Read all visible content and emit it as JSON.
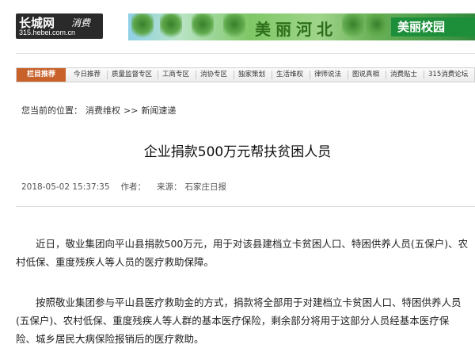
{
  "header": {
    "logo_main": "长城网",
    "logo_sub": "消费",
    "logo_url": "315.hebei.com.cn",
    "banner_title": "美丽河北",
    "banner_tag": "美丽校园"
  },
  "nav": {
    "label": "栏目推荐",
    "items": [
      "今日推荐",
      "质量监督专区",
      "工商专区",
      "消协专区",
      "独家策划",
      "生活维权",
      "律师说法",
      "图说真相",
      "消费贴士",
      "315消费论坛"
    ]
  },
  "breadcrumb": {
    "prefix": "您当前的位置：",
    "level1": "消费维权",
    "sep": ">>",
    "level2": "新闻速递"
  },
  "article": {
    "title": "企业捐款500万元帮扶贫困人员",
    "date": "2018-05-02 15:37:35",
    "author_label": "作者：",
    "source_label": "来源：",
    "source": "石家庄日报",
    "paragraphs": [
      "近日，敬业集团向平山县捐款500万元，用于对该县建档立卡贫困人口、特困供养人员(五保户)、农村低保、重度残疾人等人员的医疗救助保障。",
      "按照敬业集团参与平山县医疗救助金的方式，捐款将全部用于对建档立卡贫困人口、特困供养人员(五保户)、农村低保、重度残疾人等人群的基本医疗保险，剩余部分将用于这部分人员经基本医疗保险、城乡居民大病保险报销后的医疗救助。"
    ]
  },
  "colors": {
    "nav_head": "#c9622a",
    "banner_tag": "#1d8f3a",
    "logo_bg": "#2a2a2a"
  }
}
